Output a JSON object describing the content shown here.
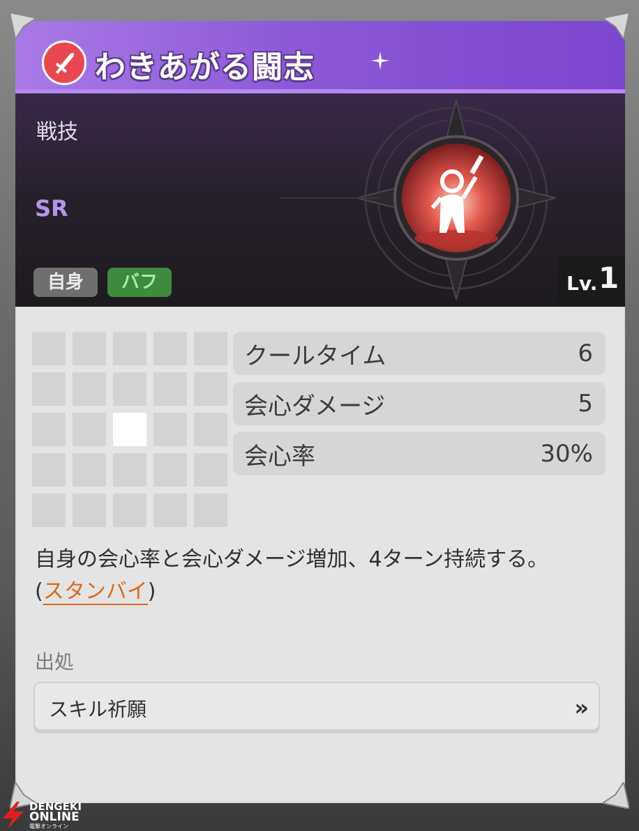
{
  "skill": {
    "title": "わきあがる闘志",
    "category": "戦技",
    "rarity": "SR",
    "tags": [
      "自身",
      "バフ"
    ],
    "level_label": "Lv.",
    "level_value": "1",
    "icon": "sword-icon",
    "emblem_icon": "rising-figure-icon"
  },
  "range_grid": {
    "rows": 5,
    "cols": 5,
    "active_cells": [
      [
        2,
        2
      ]
    ]
  },
  "stats": [
    {
      "label": "クールタイム",
      "value": "6"
    },
    {
      "label": "会心ダメージ",
      "value": "5"
    },
    {
      "label": "会心率",
      "value": "30%"
    }
  ],
  "description": {
    "line1": "自身の会心率と会心ダメージ増加、4ターン持続する。",
    "paren_open": "(",
    "keyword": "スタンバイ",
    "paren_close": ")"
  },
  "source": {
    "title": "出処",
    "item_label": "スキル祈願",
    "chevron_icon": "double-chevron-right-icon"
  },
  "watermark": {
    "line1": "DENGEKI",
    "line2": "ONLINE",
    "line3": "電撃オンライン"
  },
  "colors": {
    "title_bar": "#8c5ad8",
    "rarity": "#b595ec",
    "tag_buff": "#3e8a3f",
    "keyword": "#d96a1c",
    "icon_red": "#e8484f"
  }
}
